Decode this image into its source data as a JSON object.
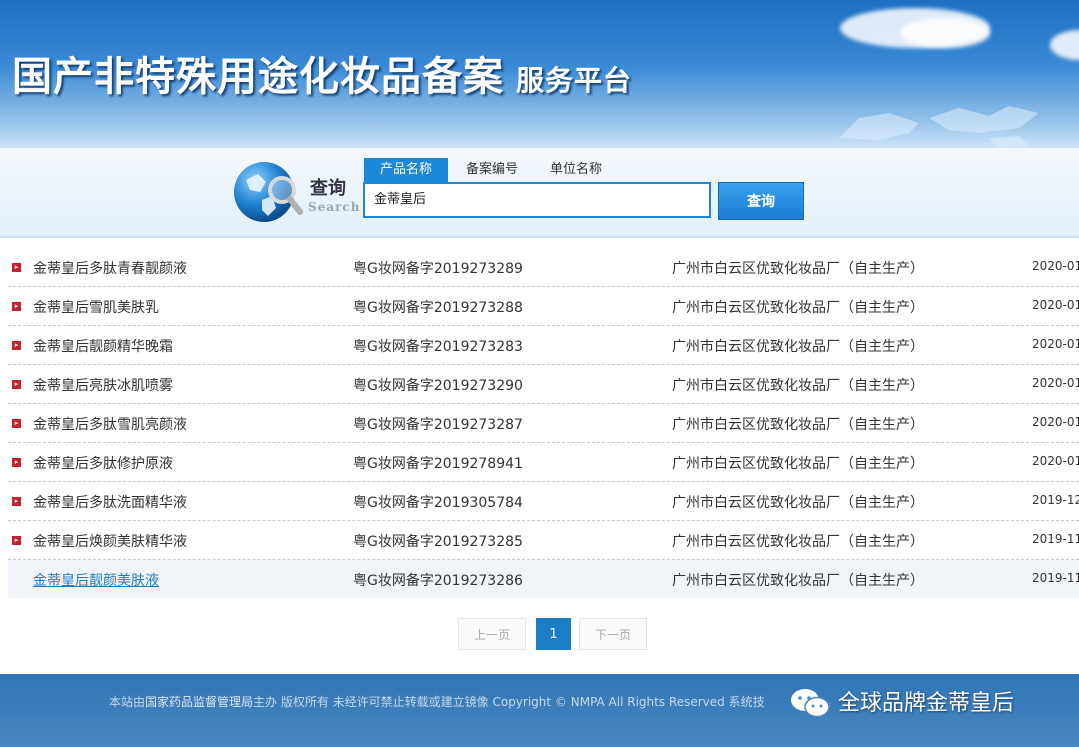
{
  "banner": {
    "title": "国产非特殊用途化妆品备案",
    "subtitle": "服务平台"
  },
  "search": {
    "label_cn": "查询",
    "label_en": "Search",
    "tabs": [
      "产品名称",
      "备案编号",
      "单位名称"
    ],
    "active_tab": "产品名称",
    "input_value": "金蒂皇后",
    "button_label": "查询",
    "icon": "globe-magnifier-icon"
  },
  "results": [
    {
      "name": "金蒂皇后多肽青春靓颜液",
      "code": "粤G妆网备字2019273289",
      "company": "广州市白云区优致化妆品厂（自主生产）",
      "date": "2020-01-"
    },
    {
      "name": "金蒂皇后雪肌美肤乳",
      "code": "粤G妆网备字2019273288",
      "company": "广州市白云区优致化妆品厂（自主生产）",
      "date": "2020-01-"
    },
    {
      "name": "金蒂皇后靓颜精华晚霜",
      "code": "粤G妆网备字2019273283",
      "company": "广州市白云区优致化妆品厂（自主生产）",
      "date": "2020-01-"
    },
    {
      "name": "金蒂皇后亮肤冰肌喷雾",
      "code": "粤G妆网备字2019273290",
      "company": "广州市白云区优致化妆品厂（自主生产）",
      "date": "2020-01-"
    },
    {
      "name": "金蒂皇后多肽雪肌亮颜液",
      "code": "粤G妆网备字2019273287",
      "company": "广州市白云区优致化妆品厂（自主生产）",
      "date": "2020-01-"
    },
    {
      "name": "金蒂皇后多肽修护原液",
      "code": "粤G妆网备字2019278941",
      "company": "广州市白云区优致化妆品厂（自主生产）",
      "date": "2020-01-"
    },
    {
      "name": "金蒂皇后多肽洗面精华液",
      "code": "粤G妆网备字2019305784",
      "company": "广州市白云区优致化妆品厂（自主生产）",
      "date": "2019-12-"
    },
    {
      "name": "金蒂皇后焕颜美肤精华液",
      "code": "粤G妆网备字2019273285",
      "company": "广州市白云区优致化妆品厂（自主生产）",
      "date": "2019-11-"
    },
    {
      "name": "金蒂皇后靓颜美肤液",
      "code": "粤G妆网备字2019273286",
      "company": "广州市白云区优致化妆品厂（自主生产）",
      "date": "2019-11-"
    }
  ],
  "pager": {
    "prev_label": "上一页",
    "current": "1",
    "next_label": "下一页"
  },
  "footer": {
    "text_a": "本站由",
    "text_b": "国家药品监督管理局",
    "text_c": "主办 版权所有 未经许可禁止转载或建立镜像 Copyright © NMPA All Rights Reserved 系统技",
    "watermark": "全球品牌金蒂皇后",
    "watermark_icon": "wechat-icon"
  },
  "colors": {
    "accent": "#1e88d8",
    "bullet": "#c8202c",
    "footer": "#3a7dbc"
  }
}
